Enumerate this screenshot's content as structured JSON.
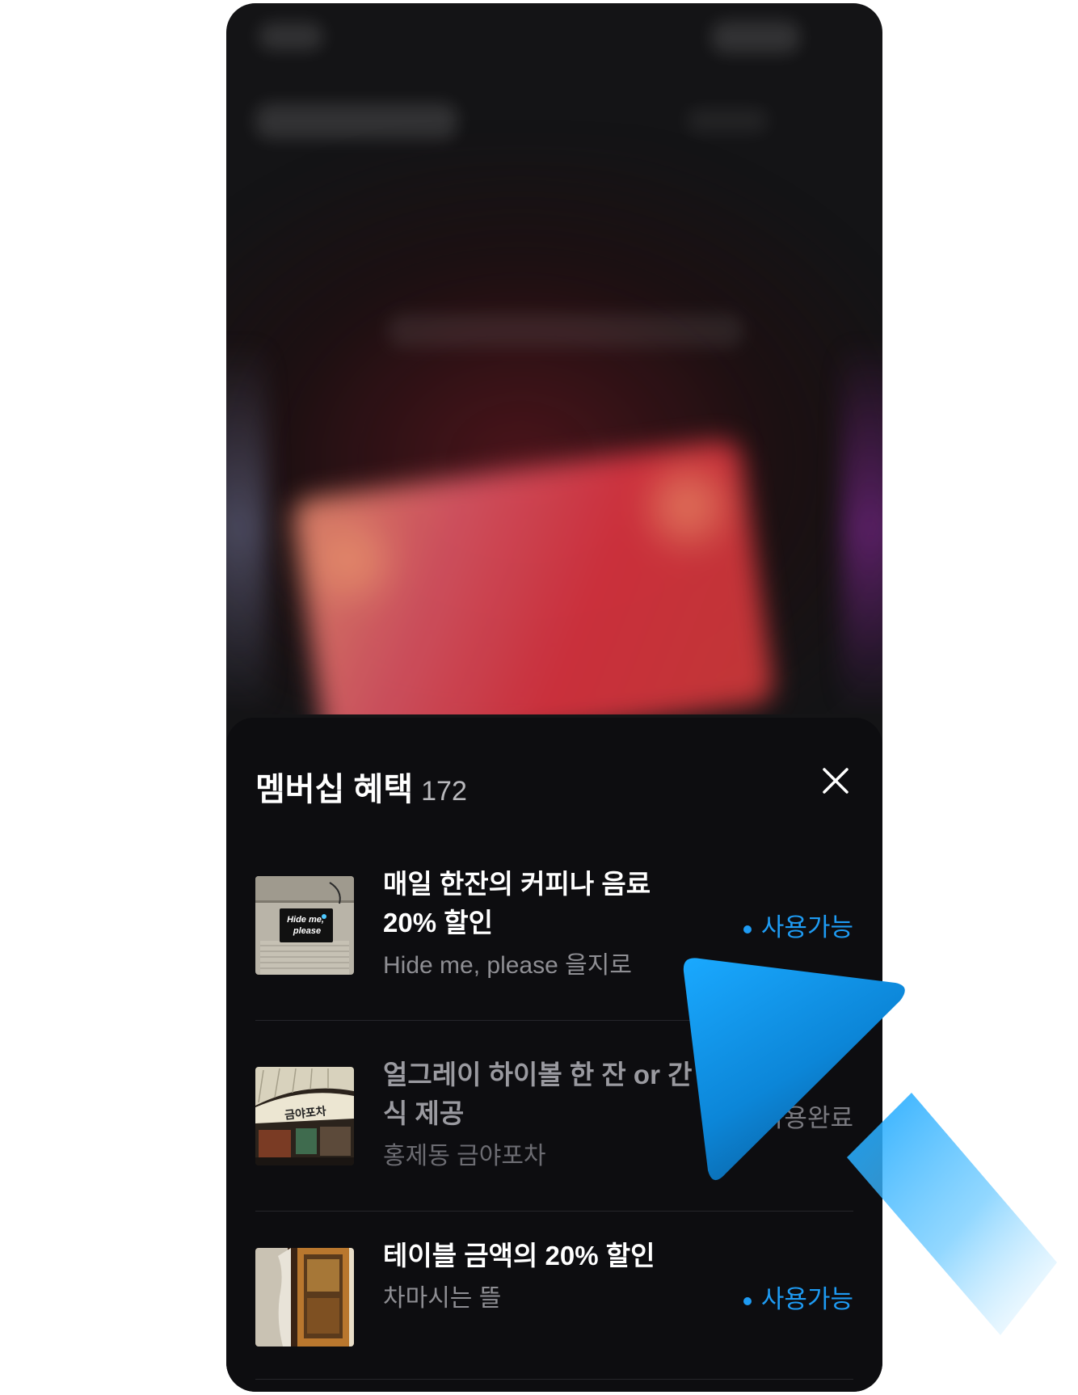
{
  "sheet": {
    "title": "멤버십 혜택",
    "count": "172"
  },
  "benefits": [
    {
      "title_line1": "매일 한잔의 커피나 음료",
      "title_line2": "20% 할인",
      "place": "Hide me, please 을지로",
      "thumb_sign_line1": "Hide me,",
      "thumb_sign_line2": "please",
      "status": "사용가능",
      "status_kind": "available"
    },
    {
      "title_line1": "얼그레이 하이볼 한 잔  or 간",
      "title_line2": "식 제공",
      "place": "홍제동 금야포차",
      "thumb_sign": "금야포차",
      "status": "사용완료",
      "status_kind": "used"
    },
    {
      "title_line1": "테이블 금액의 20% 할인",
      "place": "차마시는 뜰",
      "status": "사용가능",
      "status_kind": "available"
    }
  ],
  "icons": {
    "close": "close-icon",
    "status_dot": "dot-icon",
    "check": "check-icon",
    "pointer": "cursor-arrow-icon"
  },
  "colors": {
    "available": "#1e9bf3",
    "sheet_bg": "#0d0d10",
    "arrow": "#1aa7ff"
  }
}
